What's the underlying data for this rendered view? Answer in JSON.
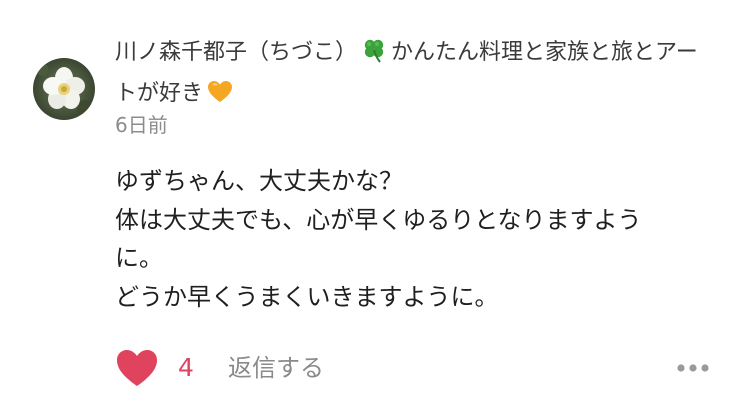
{
  "comment": {
    "author": {
      "name": "川ノ森千都子（ちづこ）",
      "bio_line1": "かんたん料理と家族と旅とアー",
      "bio_line2": "トが好き",
      "badge_icon": "four-leaf-clover-icon",
      "heart_icon": "orange-heart-icon"
    },
    "date": "6日前",
    "body": [
      "ゆずちゃん、大丈夫かな？",
      "体は大丈夫でも、心が早くゆるりとなりますよう",
      "に。",
      "どうか早くうまくいきますように。"
    ],
    "actions": {
      "like_count": "4",
      "reply_label": "返信する",
      "like_icon": "heart-icon",
      "more_icon": "more-horizontal-icon"
    },
    "colors": {
      "like_color": "#e0435d",
      "muted_text": "#8a8a8a",
      "clover_green": "#3aa33c",
      "heart_orange": "#f5a623"
    }
  }
}
